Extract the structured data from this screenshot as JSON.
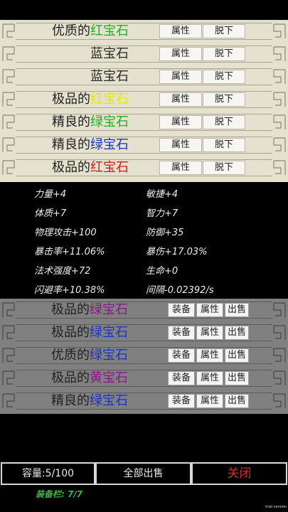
{
  "equipped": {
    "gems": [
      {
        "prefix": "优质的",
        "gem": "红宝石",
        "gem_color": "#22b022"
      },
      {
        "prefix": "",
        "gem": "蓝宝石",
        "gem_color": "#2a2a2a"
      },
      {
        "prefix": "",
        "gem": "蓝宝石",
        "gem_color": "#2a2a2a"
      },
      {
        "prefix": "极品的",
        "gem": "红宝石",
        "gem_color": "#e8e800"
      },
      {
        "prefix": "精良的",
        "gem": "绿宝石",
        "gem_color": "#22b022"
      },
      {
        "prefix": "精良的",
        "gem": "绿宝石",
        "gem_color": "#1d33c8"
      },
      {
        "prefix": "极品的",
        "gem": "红宝石",
        "gem_color": "#c81e1e"
      }
    ],
    "attr_label": "属性",
    "unequip_label": "脱下"
  },
  "stats": [
    "力量+4",
    "敏捷+4",
    "体质+7",
    "智力+7",
    "物理攻击+100",
    "防御+35",
    "暴击率+11.06%",
    "暴伤+17.03%",
    "法术强度+72",
    "生命+0",
    "闪避率+10.38%",
    "间隔-0.02392/s"
  ],
  "bag": {
    "gems": [
      {
        "prefix": "极品的",
        "gem": "绿宝石",
        "gem_color": "#8a1a8a"
      },
      {
        "prefix": "极品的",
        "gem": "绿宝石",
        "gem_color": "#1d33c8"
      },
      {
        "prefix": "优质的",
        "gem": "绿宝石",
        "gem_color": "#1d33c8"
      },
      {
        "prefix": "极品的",
        "gem": "黄宝石",
        "gem_color": "#8a1a8a"
      },
      {
        "prefix": "精良的",
        "gem": "绿宝石",
        "gem_color": "#1d33c8"
      }
    ],
    "equip_label": "装备",
    "attr_label": "属性",
    "sell_label": "出售"
  },
  "bottom": {
    "capacity": "容量:5/100",
    "sell_all": "全部出售",
    "close": "关闭",
    "equip_slots": "装备栏: 7/7"
  },
  "trial_text": "trial version",
  "colors": {
    "prefix_text": "#222222",
    "panel_light": "#e4e1cf",
    "panel_dark": "#808080",
    "close_red": "#e0241c",
    "slots_green": "#3fb43f"
  }
}
